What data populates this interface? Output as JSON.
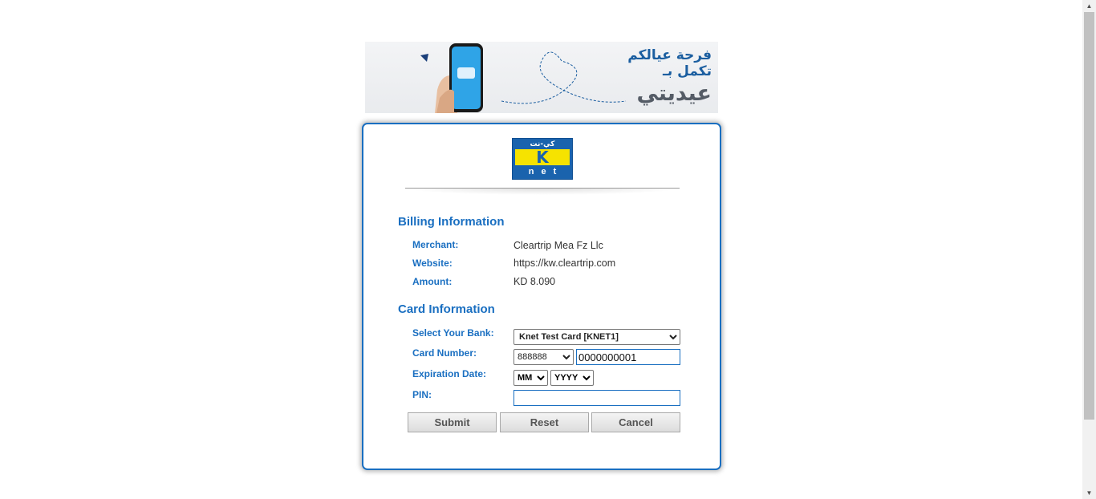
{
  "banner": {
    "text_line_1": "فرحة عيالكم",
    "text_line_2": "تكمل بـ",
    "text_line_3": "عيديتي",
    "phone_text": "عيديتي",
    "accent_color": "#1b5ea0"
  },
  "logo": {
    "arabic_mark": "كي-نت",
    "letter": "K",
    "word": "net",
    "icon": "knet-logo"
  },
  "billing": {
    "title": "Billing Information",
    "merchant_label": "Merchant:",
    "merchant_value": "Cleartrip Mea Fz Llc",
    "website_label": "Website:",
    "website_value": "https://kw.cleartrip.com",
    "amount_label": "Amount:",
    "amount_value": "KD 8.090"
  },
  "card": {
    "title": "Card Information",
    "bank_label": "Select Your Bank:",
    "bank_selected": "Knet Test Card [KNET1]",
    "card_number_label": "Card Number:",
    "card_prefix_selected": "888888",
    "card_number_value": "0000000001",
    "expiration_label": "Expiration Date:",
    "month_selected": "MM",
    "year_selected": "YYYY",
    "pin_label": "PIN:",
    "pin_value": ""
  },
  "buttons": {
    "submit": "Submit",
    "reset": "Reset",
    "cancel": "Cancel"
  },
  "colors": {
    "primary_blue": "#1a6fc1",
    "knet_yellow": "#f6e300"
  }
}
